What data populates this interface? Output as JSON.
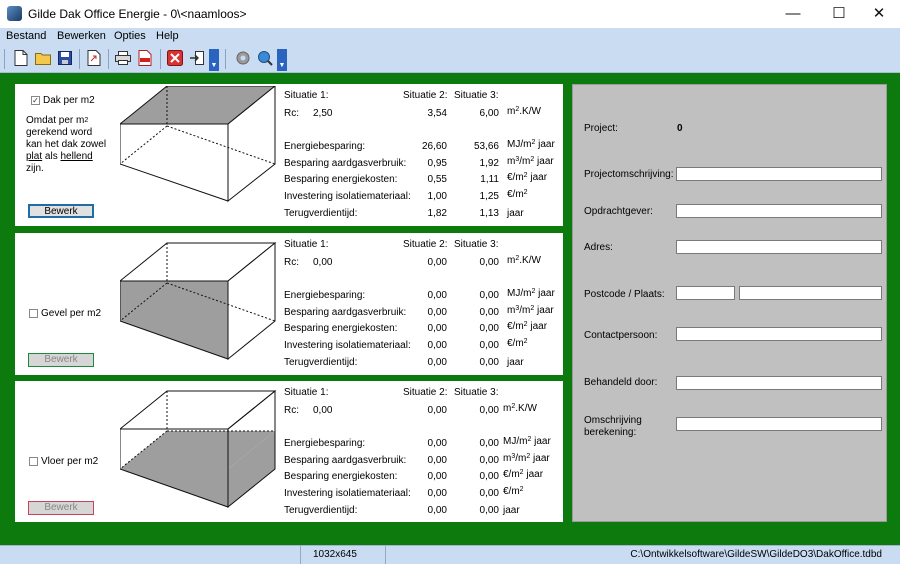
{
  "window": {
    "title": "Gilde Dak Office Energie - 0\\<naamloos>",
    "minimize": "—",
    "maximize": "☐",
    "close": "✕"
  },
  "menu": [
    "Bestand",
    "Bewerken",
    "Opties",
    "Help"
  ],
  "toolbar_icons": [
    "new-document-icon",
    "open-folder-icon",
    "save-icon",
    "export-icon",
    "print-icon",
    "pdf-icon",
    "delete-icon",
    "exit-icon",
    "settings-icon",
    "zoom-icon"
  ],
  "panels": [
    {
      "id": "dak",
      "checkbox_label": "Dak per m2",
      "checked": true,
      "note": {
        "line1_pre": "Omdat per m",
        "line1_sup": "2",
        "line2": "gerekend word",
        "line3": "kan het dak zowel",
        "plat": "plat",
        "als": "als",
        "hellend": "hellend",
        "line5": "zijn."
      },
      "button": "Bewerk",
      "button_enabled": true,
      "headers": {
        "s1": "Situatie 1:",
        "s2": "Situatie 2:",
        "s3": "Situatie 3:"
      },
      "rc": {
        "label": "Rc:",
        "s1": "2,50",
        "s2": "3,54",
        "s3": "6,00",
        "unit_pre": "m",
        "unit_sup": "2",
        "unit_post": ".K/W"
      },
      "rows": [
        {
          "label": "Energiebesparing:",
          "s2": "26,60",
          "s3": "53,66",
          "unit_pre": "MJ/m",
          "unit_sup": "2",
          "unit_post": " jaar"
        },
        {
          "label": "Besparing aardgasverbruik:",
          "s2": "0,95",
          "s3": "1,92",
          "unit_pre": "m",
          "unit_sup": "3",
          "unit_mid": "/m",
          "unit_sup2": "2",
          "unit_post": " jaar"
        },
        {
          "label": "Besparing energiekosten:",
          "s2": "0,55",
          "s3": "1,11",
          "unit_pre": "€/m",
          "unit_sup": "2",
          "unit_post": " jaar"
        },
        {
          "label": "Investering isolatiemateriaal:",
          "s2": "1,00",
          "s3": "1,25",
          "unit_pre": "€/m",
          "unit_sup": "2",
          "unit_post": ""
        },
        {
          "label": "Terugverdientijd:",
          "s2": "1,82",
          "s3": "1,13",
          "unit_pre": "jaar",
          "unit_sup": "",
          "unit_post": ""
        }
      ]
    },
    {
      "id": "gevel",
      "checkbox_label": "Gevel per m2",
      "checked": false,
      "button": "Bewerk",
      "button_enabled": false,
      "headers": {
        "s1": "Situatie 1:",
        "s2": "Situatie 2:",
        "s3": "Situatie 3:"
      },
      "rc": {
        "label": "Rc:",
        "s1": "0,00",
        "s2": "0,00",
        "s3": "0,00",
        "unit_pre": "m",
        "unit_sup": "2",
        "unit_post": ".K/W"
      },
      "rows": [
        {
          "label": "Energiebesparing:",
          "s2": "0,00",
          "s3": "0,00",
          "unit_pre": "MJ/m",
          "unit_sup": "2",
          "unit_post": " jaar"
        },
        {
          "label": "Besparing aardgasverbruik:",
          "s2": "0,00",
          "s3": "0,00",
          "unit_pre": "m",
          "unit_sup": "3",
          "unit_mid": "/m",
          "unit_sup2": "2",
          "unit_post": " jaar"
        },
        {
          "label": "Besparing energiekosten:",
          "s2": "0,00",
          "s3": "0,00",
          "unit_pre": "€/m",
          "unit_sup": "2",
          "unit_post": " jaar"
        },
        {
          "label": "Investering isolatiemateriaal:",
          "s2": "0,00",
          "s3": "0,00",
          "unit_pre": "€/m",
          "unit_sup": "2",
          "unit_post": ""
        },
        {
          "label": "Terugverdientijd:",
          "s2": "0,00",
          "s3": "0,00",
          "unit_pre": "jaar",
          "unit_sup": "",
          "unit_post": ""
        }
      ]
    },
    {
      "id": "vloer",
      "checkbox_label": "Vloer per m2",
      "checked": false,
      "button": "Bewerk",
      "button_enabled": false,
      "headers": {
        "s1": "Situatie 1:",
        "s2": "Situatie 2:",
        "s3": "Situatie 3:"
      },
      "rc": {
        "label": "Rc:",
        "s1": "0,00",
        "s2": "0,00",
        "s3": "0,00",
        "unit_pre": "m",
        "unit_sup": "2",
        "unit_post": ".K/W"
      },
      "rows": [
        {
          "label": "Energiebesparing:",
          "s2": "0,00",
          "s3": "0,00",
          "unit_pre": "MJ/m",
          "unit_sup": "2",
          "unit_post": " jaar"
        },
        {
          "label": "Besparing aardgasverbruik:",
          "s2": "0,00",
          "s3": "0,00",
          "unit_pre": "m",
          "unit_sup": "3",
          "unit_mid": "/m",
          "unit_sup2": "2",
          "unit_post": " jaar"
        },
        {
          "label": "Besparing energiekosten:",
          "s2": "0,00",
          "s3": "0,00",
          "unit_pre": "€/m",
          "unit_sup": "2",
          "unit_post": " jaar"
        },
        {
          "label": "Investering isolatiemateriaal:",
          "s2": "0,00",
          "s3": "0,00",
          "unit_pre": "€/m",
          "unit_sup": "2",
          "unit_post": ""
        },
        {
          "label": "Terugverdientijd:",
          "s2": "0,00",
          "s3": "0,00",
          "unit_pre": "jaar",
          "unit_sup": "",
          "unit_post": ""
        }
      ]
    }
  ],
  "project": {
    "project_label": "Project:",
    "project_value": "0",
    "omschrijving_label": "Projectomschrijving:",
    "omschrijving_value": "",
    "opdrachtgever_label": "Opdrachtgever:",
    "opdrachtgever_value": "",
    "adres_label": "Adres:",
    "adres_value": "",
    "postcode_label": "Postcode / Plaats:",
    "postcode_value": "",
    "plaats_value": "",
    "contact_label": "Contactpersoon:",
    "contact_value": "",
    "behandeld_label": "Behandeld door:",
    "behandeld_value": "",
    "berekening_line1": "Omschrijving",
    "berekening_line2": "berekening:",
    "berekening_value": ""
  },
  "status": {
    "resolution": "1032x645",
    "path": "C:\\Ontwikkelsoftware\\GildeSW\\GildeDO3\\DakOffice.tdbd"
  }
}
